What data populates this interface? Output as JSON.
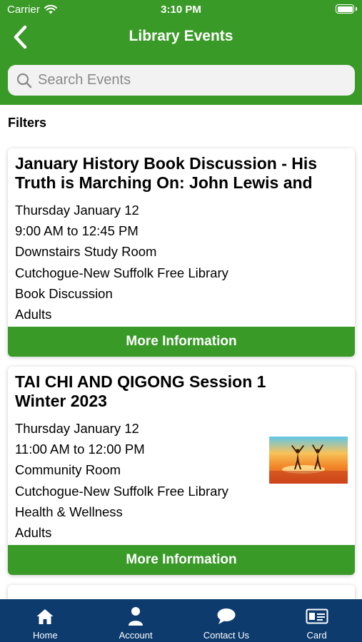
{
  "status_bar": {
    "carrier": "Carrier",
    "time": "3:10 PM"
  },
  "nav": {
    "back_icon": "chevron-left-icon",
    "title": "Library Events"
  },
  "search": {
    "placeholder": "Search Events",
    "value": ""
  },
  "filters_label": "Filters",
  "events": [
    {
      "title_line1": "January History Book Discussion - His",
      "title_line2": "Truth is Marching On: John Lewis and",
      "date": "Thursday January 12",
      "time": "9:00 AM to 12:45 PM",
      "room": "Downstairs Study Room",
      "library": "Cutchogue-New Suffolk Free Library",
      "category": "Book Discussion",
      "audience": "Adults",
      "button": "More Information"
    },
    {
      "title_line1": "TAI CHI AND QIGONG Session 1",
      "title_line2": "Winter 2023",
      "date": "Thursday January 12",
      "time": "11:00 AM to 12:00 PM",
      "room": "Community Room",
      "library": "Cutchogue-New Suffolk Free Library",
      "category": "Health & Wellness",
      "audience": "Adults",
      "button": "More Information"
    }
  ],
  "tabbar": [
    {
      "label": "Home",
      "icon": "home-icon"
    },
    {
      "label": "Account",
      "icon": "person-icon"
    },
    {
      "label": "Contact Us",
      "icon": "chat-bubble-icon"
    },
    {
      "label": "Card",
      "icon": "library-card-icon"
    }
  ],
  "colors": {
    "brand_green": "#3a9a28",
    "tabbar_navy": "#0d3b6e"
  }
}
